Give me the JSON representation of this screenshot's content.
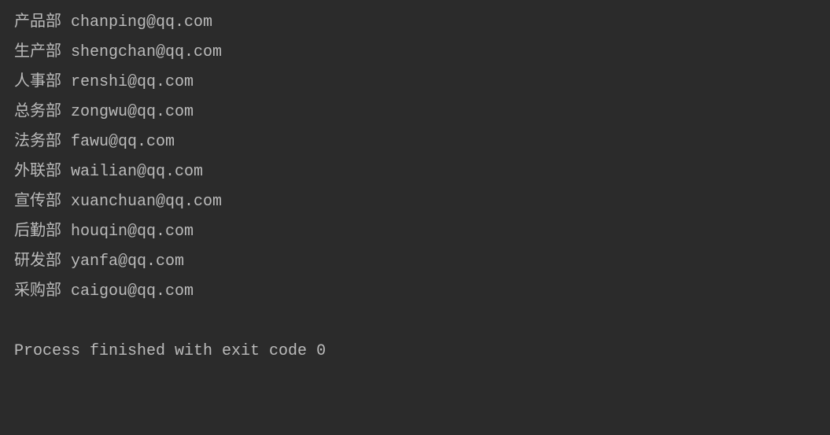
{
  "output": {
    "lines": [
      {
        "dept": "产品部",
        "email": "chanping@qq.com"
      },
      {
        "dept": "生产部",
        "email": "shengchan@qq.com"
      },
      {
        "dept": "人事部",
        "email": "renshi@qq.com"
      },
      {
        "dept": "总务部",
        "email": "zongwu@qq.com"
      },
      {
        "dept": "法务部",
        "email": "fawu@qq.com"
      },
      {
        "dept": "外联部",
        "email": "wailian@qq.com"
      },
      {
        "dept": "宣传部",
        "email": "xuanchuan@qq.com"
      },
      {
        "dept": "后勤部",
        "email": "houqin@qq.com"
      },
      {
        "dept": "研发部",
        "email": "yanfa@qq.com"
      },
      {
        "dept": "采购部",
        "email": "caigou@qq.com"
      }
    ]
  },
  "status": {
    "message": "Process finished with exit code 0"
  }
}
